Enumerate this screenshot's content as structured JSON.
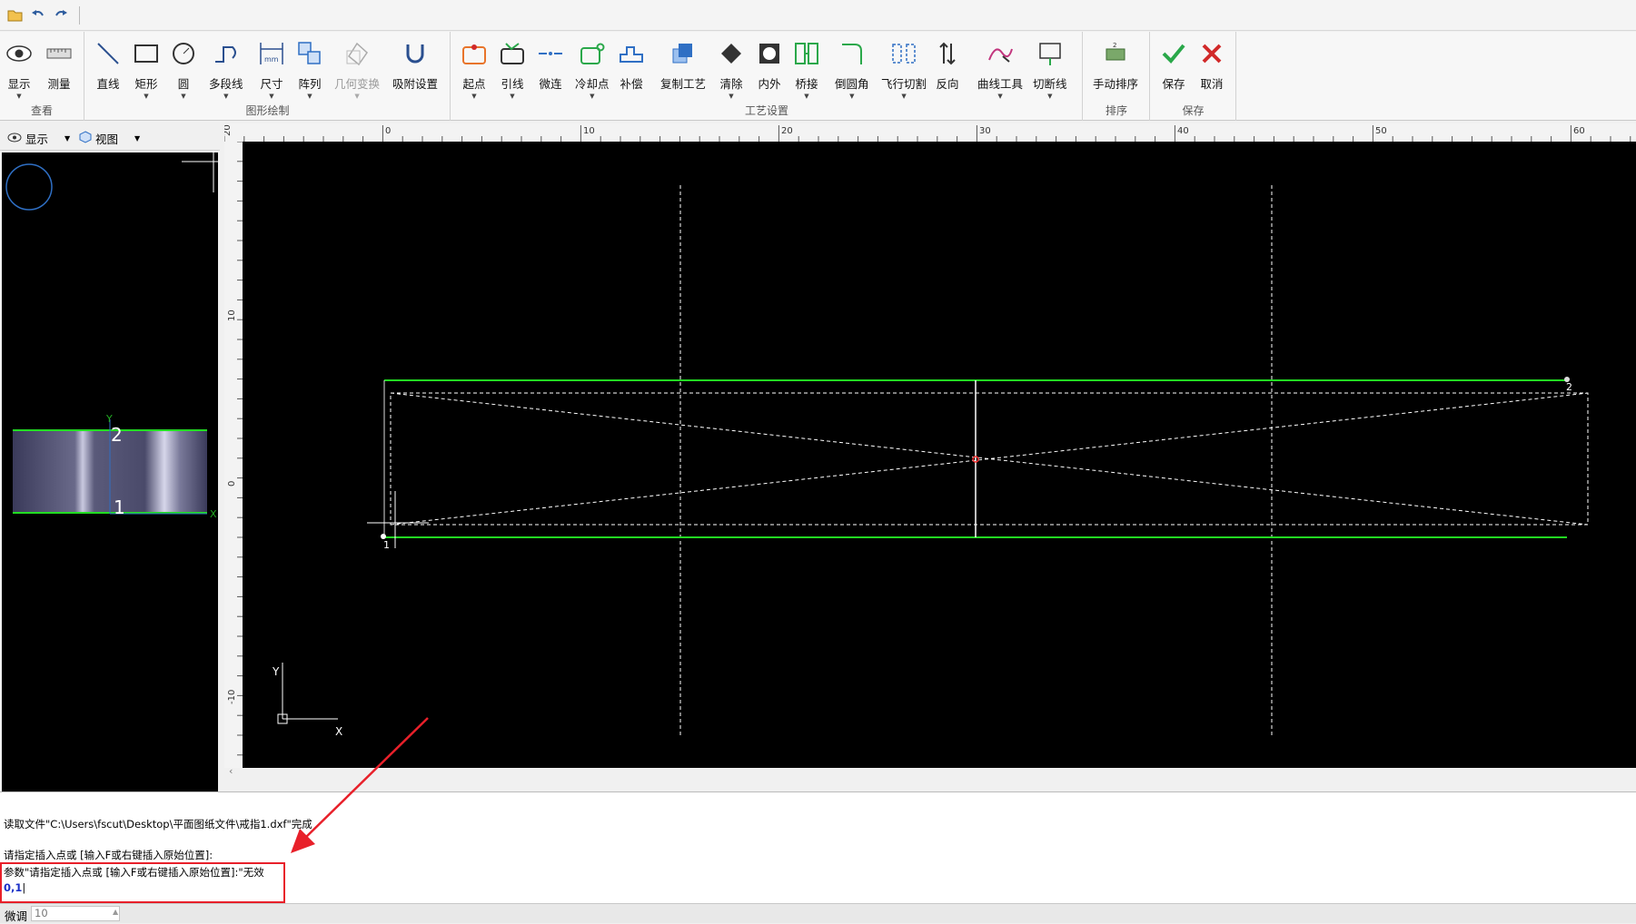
{
  "quick_access": {
    "icons": [
      "open-folder-icon",
      "undo-icon",
      "redo-icon"
    ]
  },
  "ribbon": {
    "groups": {
      "view": {
        "label": "查看",
        "buttons": {
          "display": "显示",
          "measure": "测量"
        }
      },
      "draw": {
        "label": "图形绘制",
        "buttons": {
          "line": "直线",
          "rect": "矩形",
          "circle": "圆",
          "polyline": "多段线",
          "dimension": "尺寸",
          "array": "阵列",
          "geo_transform": "几何变换",
          "snap": "吸附设置"
        }
      },
      "process": {
        "label": "工艺设置",
        "buttons": {
          "start": "起点",
          "lead": "引线",
          "microjoint": "微连",
          "cooling": "冷却点",
          "compensate": "补偿",
          "copy_process": "复制工艺",
          "clear": "清除",
          "inner_outer": "内外",
          "bridge": "桥接",
          "chamfer": "倒圆角",
          "flycut": "飞行切割",
          "reverse": "反向",
          "curve_tools": "曲线工具",
          "cutline": "切断线"
        }
      },
      "sort": {
        "label": "排序",
        "buttons": {
          "manual_sort": "手动排序"
        }
      },
      "save": {
        "label": "保存",
        "buttons": {
          "save": "保存",
          "cancel": "取消"
        }
      }
    },
    "colors": {
      "accent_orange": "#e8742a",
      "accent_green": "#2aa84a",
      "accent_blue": "#2f6fc4",
      "cancel_red": "#d12a2a"
    }
  },
  "left_panel": {
    "display_label": "显示",
    "view_label": "视图",
    "preview": {
      "marker_top": "2",
      "marker_bottom": "1",
      "axis_y": "Y",
      "axis_x": "X"
    }
  },
  "canvas": {
    "ruler_top_labels": [
      "20",
      "0",
      "10",
      "20",
      "30",
      "40",
      "50",
      "60"
    ],
    "ruler_left_labels": [
      "10",
      "0",
      "-10"
    ],
    "marker_start": "1",
    "marker_end": "2",
    "axis_y": "Y",
    "axis_x": "X"
  },
  "command_panel": {
    "line1": "读取文件\"C:\\Users\\fscut\\Desktop\\平面图纸文件\\戒指1.dxf\"完成",
    "line2": "请指定插入点或 [输入F或右键插入原始位置]:",
    "line3": "参数\"请指定插入点或 [输入F或右键插入原始位置]:\"无效",
    "input_value": "0,1"
  },
  "status_bar": {
    "label": "微调",
    "value": "10"
  }
}
